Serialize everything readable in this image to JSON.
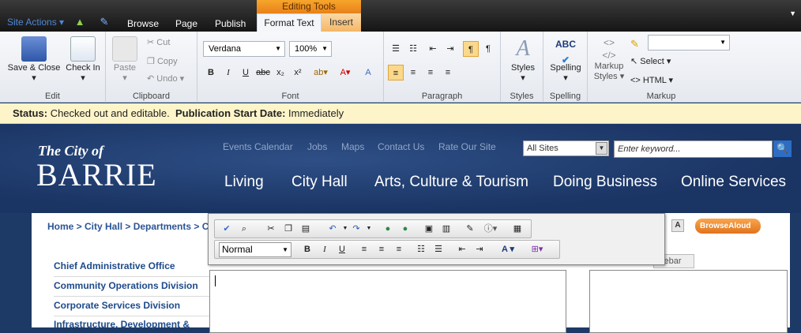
{
  "topbar": {
    "site_actions": "Site Actions",
    "tabs": [
      "Browse",
      "Page",
      "Publish"
    ],
    "context_group": "Editing Tools",
    "context_tabs": [
      "Format Text",
      "Insert"
    ]
  },
  "ribbon": {
    "edit": {
      "label": "Edit",
      "save_close": "Save & Close",
      "check_in": "Check In"
    },
    "clipboard": {
      "label": "Clipboard",
      "paste": "Paste",
      "cut": "Cut",
      "copy": "Copy",
      "undo": "Undo"
    },
    "font": {
      "label": "Font",
      "family": "Verdana",
      "size": "100%"
    },
    "paragraph": {
      "label": "Paragraph"
    },
    "styles": {
      "label": "Styles",
      "button": "Styles"
    },
    "spelling": {
      "label": "Spelling",
      "button": "Spelling",
      "abc": "ABC"
    },
    "markup": {
      "label": "Markup",
      "markup_styles_1": "Markup",
      "markup_styles_2": "Styles",
      "select": "Select",
      "html": "HTML"
    }
  },
  "status": {
    "status_label": "Status:",
    "status_value": "Checked out and editable.",
    "pub_label": "Publication Start Date:",
    "pub_value": "Immediately"
  },
  "header": {
    "logo_top": "The City of",
    "logo_main": "BARRIE",
    "links": [
      "Events Calendar",
      "Jobs",
      "Maps",
      "Contact Us",
      "Rate Our Site"
    ],
    "scope": "All Sites",
    "search_placeholder": "Enter keyword...",
    "nav": [
      "Living",
      "City Hall",
      "Arts, Culture & Tourism",
      "Doing Business",
      "Online Services"
    ]
  },
  "content": {
    "breadcrumb": "Home  > City Hall > Departments > Co",
    "browse_aloud": "BrowseAloud",
    "text_size": "A",
    "left_nav": [
      "Chief Administrative Office",
      "Community Operations Division",
      "Corporate Services Division",
      "Infrastructure, Development &"
    ],
    "sidebar_tab": "idebar"
  },
  "rte": {
    "format": "Normal"
  },
  "colors": {
    "accent": "#f7a52a",
    "nav_bg": "#1d3a66",
    "status_bg": "#fdf5c9"
  }
}
